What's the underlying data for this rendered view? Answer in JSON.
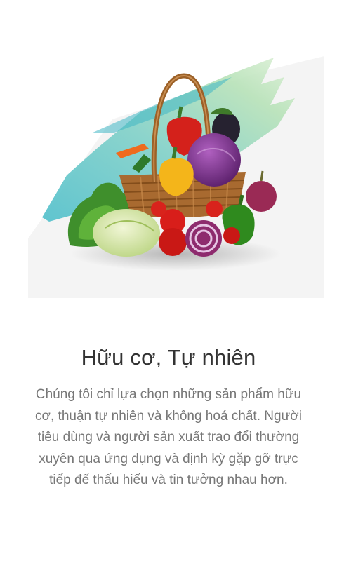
{
  "onboarding": {
    "image_icon": "vegetable-basket-illustration",
    "title": "Hữu cơ, Tự nhiên",
    "description": "Chúng tôi chỉ lựa chọn những sản phẩm hữu cơ, thuận tự nhiên và không hoá chất. Người tiêu dùng và người sản xuất trao đổi thường xuyên qua ứng dụng và định kỳ gặp gỡ trực tiếp để thấu hiểu và tin tưởng nhau hơn."
  },
  "colors": {
    "background": "#ffffff",
    "title": "#333333",
    "description": "#777777",
    "brush_teal": "#5cc6cf",
    "brush_green": "#a9dcb0"
  }
}
